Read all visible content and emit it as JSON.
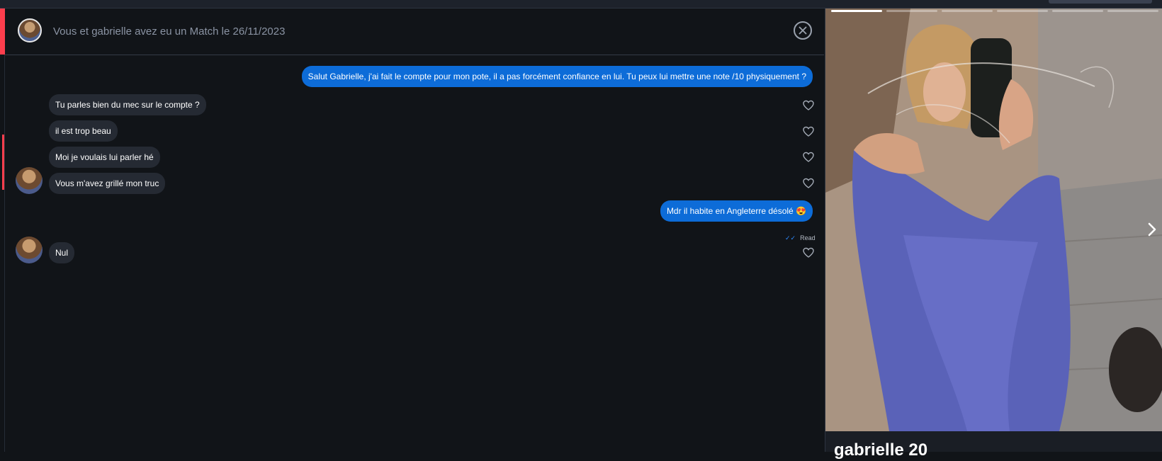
{
  "header": {
    "match_text": "Vous et gabrielle avez eu un Match le 26/11/2023"
  },
  "messages": [
    {
      "direction": "out",
      "text": "Salut Gabrielle, j'ai fait le compte pour mon pote, il a pas forcément confiance en lui. Tu peux lui mettre une note /10 physiquement ?"
    },
    {
      "direction": "in",
      "text": "Tu parles bien du mec sur le compte ?"
    },
    {
      "direction": "in",
      "text": "il est trop beau"
    },
    {
      "direction": "in",
      "text": "Moi je voulais lui parler hé"
    },
    {
      "direction": "in",
      "text": "Vous m'avez grillé mon truc"
    },
    {
      "direction": "out",
      "text": "Mdr il habite en Angleterre désolé 😍"
    },
    {
      "direction": "in",
      "text": "Nul"
    }
  ],
  "read_status": "Read",
  "read_check": "✓✓",
  "profile": {
    "name_age": "gabrielle 20",
    "photo_count": 6,
    "active_photo": 1
  },
  "colors": {
    "accent": "#fd3e4d",
    "outgoing_bubble": "#0d6cd8",
    "incoming_bubble": "#252a33",
    "background": "#111418"
  },
  "icons": {
    "close": "close-circle-icon",
    "like": "heart-outline-icon",
    "next": "chevron-right-icon",
    "read": "double-check-icon"
  }
}
